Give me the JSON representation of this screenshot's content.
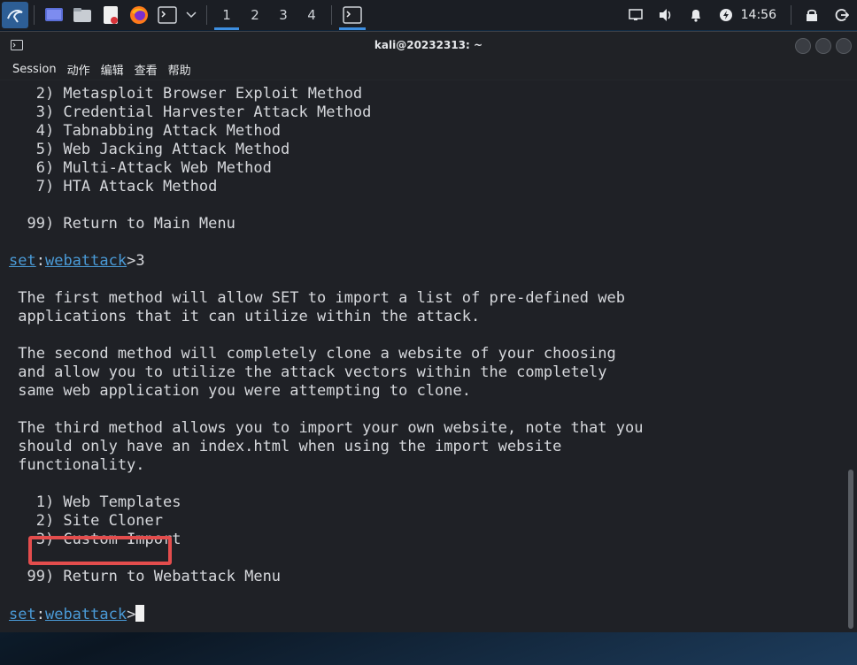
{
  "panel": {
    "workspaces": [
      "1",
      "2",
      "3",
      "4"
    ],
    "clock": "14:56"
  },
  "window": {
    "title": "kali@20232313: ~"
  },
  "menu": [
    "Session",
    "动作",
    "编辑",
    "查看",
    "帮助"
  ],
  "terminal": {
    "lines": [
      "   2) Metasploit Browser Exploit Method",
      "   3) Credential Harvester Attack Method",
      "   4) Tabnabbing Attack Method",
      "   5) Web Jacking Attack Method",
      "   6) Multi-Attack Web Method",
      "   7) HTA Attack Method",
      "",
      "  99) Return to Main Menu",
      "",
      "",
      "",
      " The first method will allow SET to import a list of pre-defined web",
      " applications that it can utilize within the attack.",
      "",
      " The second method will completely clone a website of your choosing",
      " and allow you to utilize the attack vectors within the completely",
      " same web application you were attempting to clone.",
      "",
      " The third method allows you to import your own website, note that you",
      " should only have an index.html when using the import website",
      " functionality.",
      "",
      "   1) Web Templates",
      "   2) Site Cloner",
      "   3) Custom Import",
      "",
      "  99) Return to Webattack Menu",
      ""
    ],
    "prompt1": {
      "a": "set",
      "colon": ":",
      "b": "webattack",
      "rest": ">3"
    },
    "prompt2": {
      "a": "set",
      "colon": ":",
      "b": "webattack",
      "rest": ">"
    }
  },
  "colors": {
    "highlight": "#e34d4d",
    "accent": "#3d8ee0"
  }
}
